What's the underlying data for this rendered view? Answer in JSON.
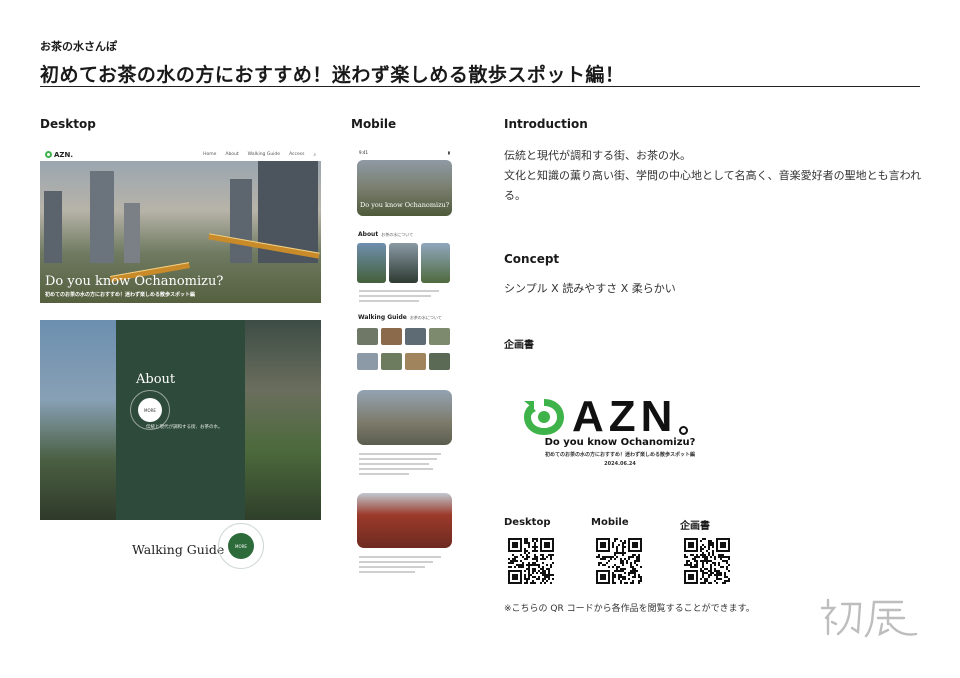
{
  "header": {
    "kicker": "お茶の水さんぽ",
    "title": "初めてお茶の水の方におすすめ！迷わず楽しめる散歩スポット編！"
  },
  "sections": {
    "desktop": "Desktop",
    "mobile": "Mobile",
    "introduction": "Introduction",
    "concept": "Concept",
    "plan": "企画書"
  },
  "introduction": {
    "line1": "伝統と現代が調和する街、お茶の水。",
    "line2": "文化と知識の薫り高い街、学問の中心地として名高く、音楽愛好者の聖地とも言われる。"
  },
  "concept": {
    "text": "シンプル X 読みやすさ X 柔らかい"
  },
  "desktop_mock": {
    "logo": "AZN.",
    "nav": [
      "Home",
      "About",
      "Walking Guide",
      "Access"
    ],
    "search_icon": "search-icon",
    "hero_title": "Do you know Ochanomizu?",
    "hero_sub": "初めてのお茶の水の方におすすめ！迷わず楽しめる散歩スポット編",
    "about_title": "About",
    "about_more": "MORE",
    "about_text": "伝統と現代が調和する街、お茶の水。",
    "walk_title": "Walking Guide",
    "walk_more": "MORE"
  },
  "mobile_mock": {
    "time": "9:41",
    "hero_title": "Do you know Ochanomizu?",
    "about_title": "About",
    "about_sub": "お茶の水について",
    "walk_title": "Walking Guide",
    "walk_sub": "お茶の水について"
  },
  "plan_doc": {
    "logo": "AZN",
    "tagline": "Do you know Ochanomizu?",
    "sub": "初めてのお茶の水の方におすすめ！迷わず楽しめる散歩スポット編",
    "date": "2024.06.24"
  },
  "qr": {
    "desktop": "Desktop",
    "mobile": "Mobile",
    "plan": "企画書",
    "note": "※こちらの QR コードから各作品を閲覧することができます。"
  },
  "colors": {
    "brand_green": "#3db34a",
    "forest": "#2e4a3a",
    "text": "#1a1a1a"
  }
}
